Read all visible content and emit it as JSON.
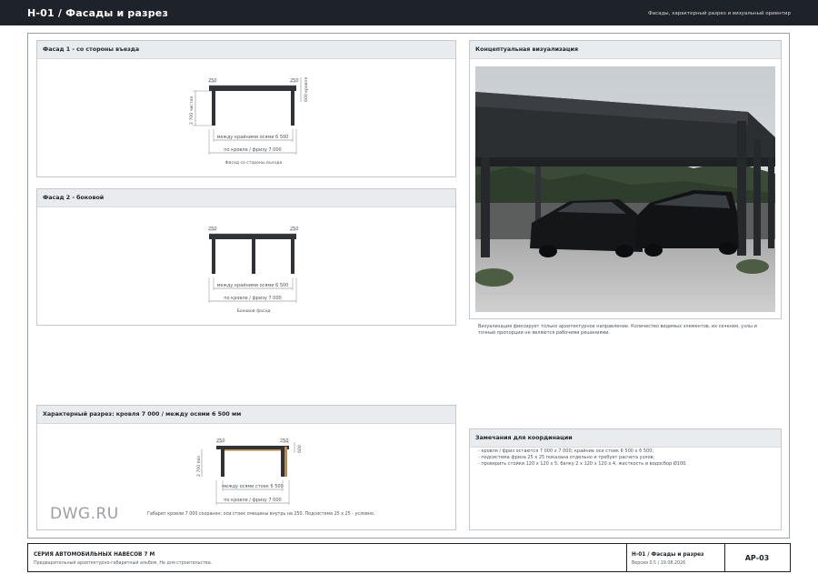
{
  "header": {
    "title": "Н-01 / Фасады и разрез",
    "subtitle": "Фасады, характерный разрез и визуальный ориентир"
  },
  "facade1": {
    "title": "Фасад 1 - со стороны въезда",
    "dim_left": "250",
    "dim_right": "250",
    "dim_height": "2 700 чистая",
    "dim_roof": "600 кровля",
    "dim_axes": "между крайними осями 6 500",
    "dim_total": "по кровле / фризу 7 000",
    "caption": "Фасад со стороны въезда"
  },
  "facade2": {
    "title": "Фасад 2 - боковой",
    "dim_left": "250",
    "dim_right": "250",
    "dim_axes": "между крайними осями 6 500",
    "dim_total": "по кровле / фризу 7 000",
    "caption": "Боковой фасад"
  },
  "visual": {
    "title": "Концептуальная визуализация",
    "note": "Визуализация фиксирует только архитектурное направление. Количество видимых элементов, их сечения, узлы и точные пропорции не являются рабочими решениями."
  },
  "section": {
    "title": "Характерный разрез: кровля 7 000 / между осями 6 500 мм",
    "dim_left": "250",
    "dim_right": "250",
    "dim_height": "2 700 min",
    "dim_roof": "600",
    "dim_axes": "между осями стоек 6 500",
    "dim_total": "по кровле / фризу 7 000",
    "caption": "Габарит кровли 7 000 сохранен; оси стоек смещены внутрь на 250. Подсистема 25 х 25 - условно."
  },
  "coordination": {
    "title": "Замечания для координации",
    "lines": [
      "- кровля / фриз остаются 7 000 х 7 000; крайние оси стоек 6 500 х 6 500;",
      "- подсистема фриза 25 х 25 показана отдельно и требует расчета узлов;",
      "- проверить стойки 120 х 120 х 5, балку 2 х 120 х 120 х 4, жесткость и водосбор Ø100."
    ]
  },
  "watermark": "DWG.RU",
  "titleblock": {
    "series": "СЕРИЯ АВТОМОБИЛЬНЫХ НАВЕСОВ 7 М",
    "series_note": "Предварительный архитектурно-габаритный альбом. Не для строительства.",
    "sheet_name": "Н-01 / Фасады и разрез",
    "version": "Версия 0.5 / 19.08.2026",
    "sheet_code": "АР-03"
  },
  "colors": {
    "header_bg": "#1e2329",
    "panel_header": "#e9ecef",
    "frame": "#2f3337",
    "timber": "#c58a3e",
    "dim_line": "#6b7177"
  }
}
